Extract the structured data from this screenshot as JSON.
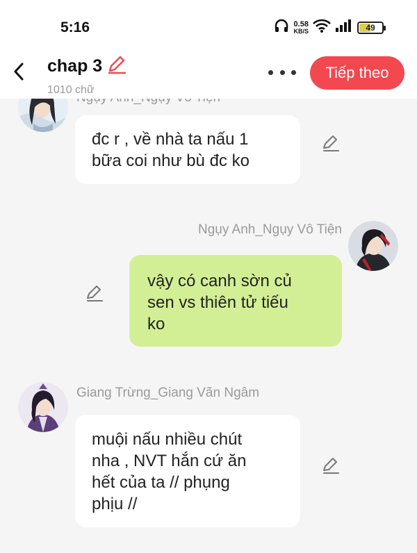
{
  "status": {
    "time": "5:16",
    "net_speed_value": "0.58",
    "net_speed_unit": "KB/S",
    "battery": "49"
  },
  "header": {
    "title": "chap 3",
    "word_count": "1010 chữ",
    "next_label": "Tiếp theo"
  },
  "messages": [
    {
      "side": "left",
      "sender": "Ngụy Anh_Ngụy Vô Tiện",
      "text": "đc r , về nhà ta nấu 1 bữa coi như bù đc ko",
      "line1": "đc r , về nhà ta nấu 1",
      "line2": "bữa coi như bù đc ko"
    },
    {
      "side": "right",
      "sender": "Ngụy Anh_Ngụy Vô Tiện",
      "line1": "vậy có canh sờn củ",
      "line2": "sen vs thiên tử tiếu",
      "line3": "ko"
    },
    {
      "side": "left",
      "sender": "Giang Trừng_Giang Vãn Ngâm",
      "line1": "muội nấu nhiều chút",
      "line2": "nha , NVT hắn cứ ăn",
      "line3": "hết của ta // phụng",
      "line4": "phịu //"
    }
  ],
  "colors": {
    "accent": "#f2484f",
    "green_bubble": "#d3ef96",
    "background": "#f5f5f5"
  }
}
